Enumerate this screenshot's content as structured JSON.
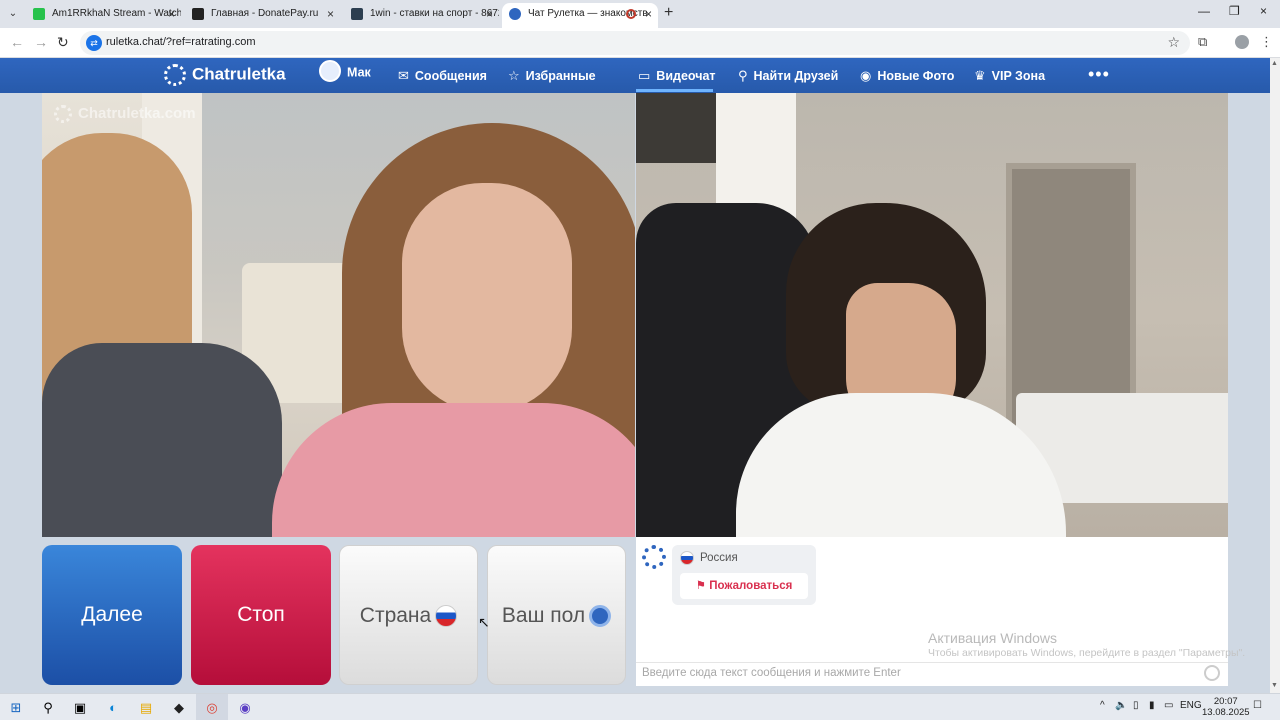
{
  "browser": {
    "tabs": [
      {
        "title": "Am1RRkhaN Stream - Watch L",
        "favicon_color": "#27c24c",
        "active": false
      },
      {
        "title": "Главная - DonatePay.ru",
        "favicon_color": "#222222",
        "active": false
      },
      {
        "title": "1win - ставки на спорт - 8672",
        "favicon_color": "#2c3e50",
        "active": false
      },
      {
        "title": "Чат Рулетка — знакомств",
        "favicon_color": "#2f66bf",
        "active": true
      }
    ],
    "url": "ruletka.chat/?ref=ratrating.com",
    "icons": {
      "back": "←",
      "forward": "→",
      "reload": "↻",
      "star": "☆",
      "extensions": "⧉",
      "menu": "⋮",
      "tab_list": "⌄",
      "new_tab": "+",
      "close": "×",
      "minimize": "—",
      "maximize": "❐"
    }
  },
  "site": {
    "logo": "Chatruletka",
    "nav": {
      "profile": "Мак",
      "messages": "Сообщения",
      "favorites": "Избранные",
      "videochat": "Видеочат",
      "find_friends": "Найти Друзей",
      "new_photos": "Новые Фото",
      "vip": "VIP Зона",
      "more": "•••"
    },
    "nav_icons": {
      "messages": "✉",
      "favorites": "☆",
      "videochat": "▭",
      "find_friends": "⚲",
      "new_photos": "◉",
      "vip": "♛"
    },
    "colors": {
      "header": "#2f66bf",
      "next_button": "#2a6bc6",
      "stop_button": "#d01d4a",
      "report": "#d9304f"
    }
  },
  "video": {
    "watermark": "Chatruletka.com"
  },
  "controls": {
    "next": "Далее",
    "stop": "Стоп",
    "country": "Страна",
    "gender": "Ваш пол"
  },
  "chat": {
    "partner_country": "Россия",
    "report": "Пожаловаться",
    "report_icon": "⚑",
    "input_placeholder": "Введите сюда текст сообщения и нажмите Enter"
  },
  "os": {
    "activation_title": "Активация Windows",
    "activation_subtitle": "Чтобы активировать Windows, перейдите в раздел \"Параметры\".",
    "language": "ENG",
    "time": "20:07",
    "date": "13.08.2025",
    "taskbar_icons": {
      "start": "⊞",
      "search": "⚲",
      "task_view": "▣",
      "edge": "◐",
      "explorer": "▤",
      "app1": "◆",
      "chrome": "◎",
      "app2": "◉"
    },
    "tray_icons": {
      "chevron": "^",
      "speaker": "🔈",
      "network": "▯",
      "mic": "▮",
      "battery": "▭",
      "notifications": "☐"
    }
  }
}
